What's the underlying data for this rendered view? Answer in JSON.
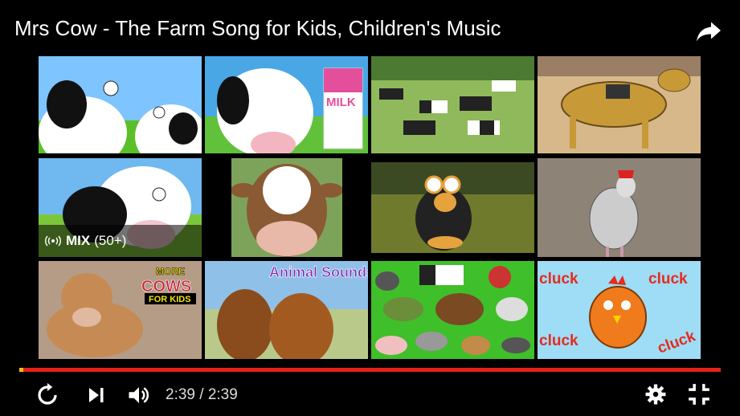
{
  "video": {
    "title": "Mrs Cow - The Farm Song for Kids, Children's Music"
  },
  "mix": {
    "label": "MIX",
    "count": "(50+)"
  },
  "thumbnails": [
    {
      "name": "cartoon-cows-thumb"
    },
    {
      "name": "cow-with-milk-carton-thumb",
      "text": "MILK"
    },
    {
      "name": "cows-in-field-thumb"
    },
    {
      "name": "cartoon-horse-thumb"
    },
    {
      "name": "mix-cow-thumb"
    },
    {
      "name": "cow-closeup-thumb"
    },
    {
      "name": "cartoon-duck-thumb"
    },
    {
      "name": "rooster-thumb"
    },
    {
      "name": "calf-thumb",
      "text_line1": "MORE",
      "text_line2": "COWS",
      "text_line3": "FOR KIDS"
    },
    {
      "name": "horses-thumb",
      "text": "Animal Sounds"
    },
    {
      "name": "farm-animals-thumb"
    },
    {
      "name": "cartoon-chicken-thumb",
      "text": "cluck"
    }
  ],
  "player": {
    "current_time": "2:39",
    "separator": "/",
    "duration": "2:39",
    "progress_fraction": 1.0,
    "accent_color": "#e62117"
  },
  "icons": {
    "share": "share-icon",
    "replay": "replay-icon",
    "next": "next-icon",
    "volume": "volume-icon",
    "settings": "gear-icon",
    "exit_fullscreen": "exit-fullscreen-icon"
  }
}
